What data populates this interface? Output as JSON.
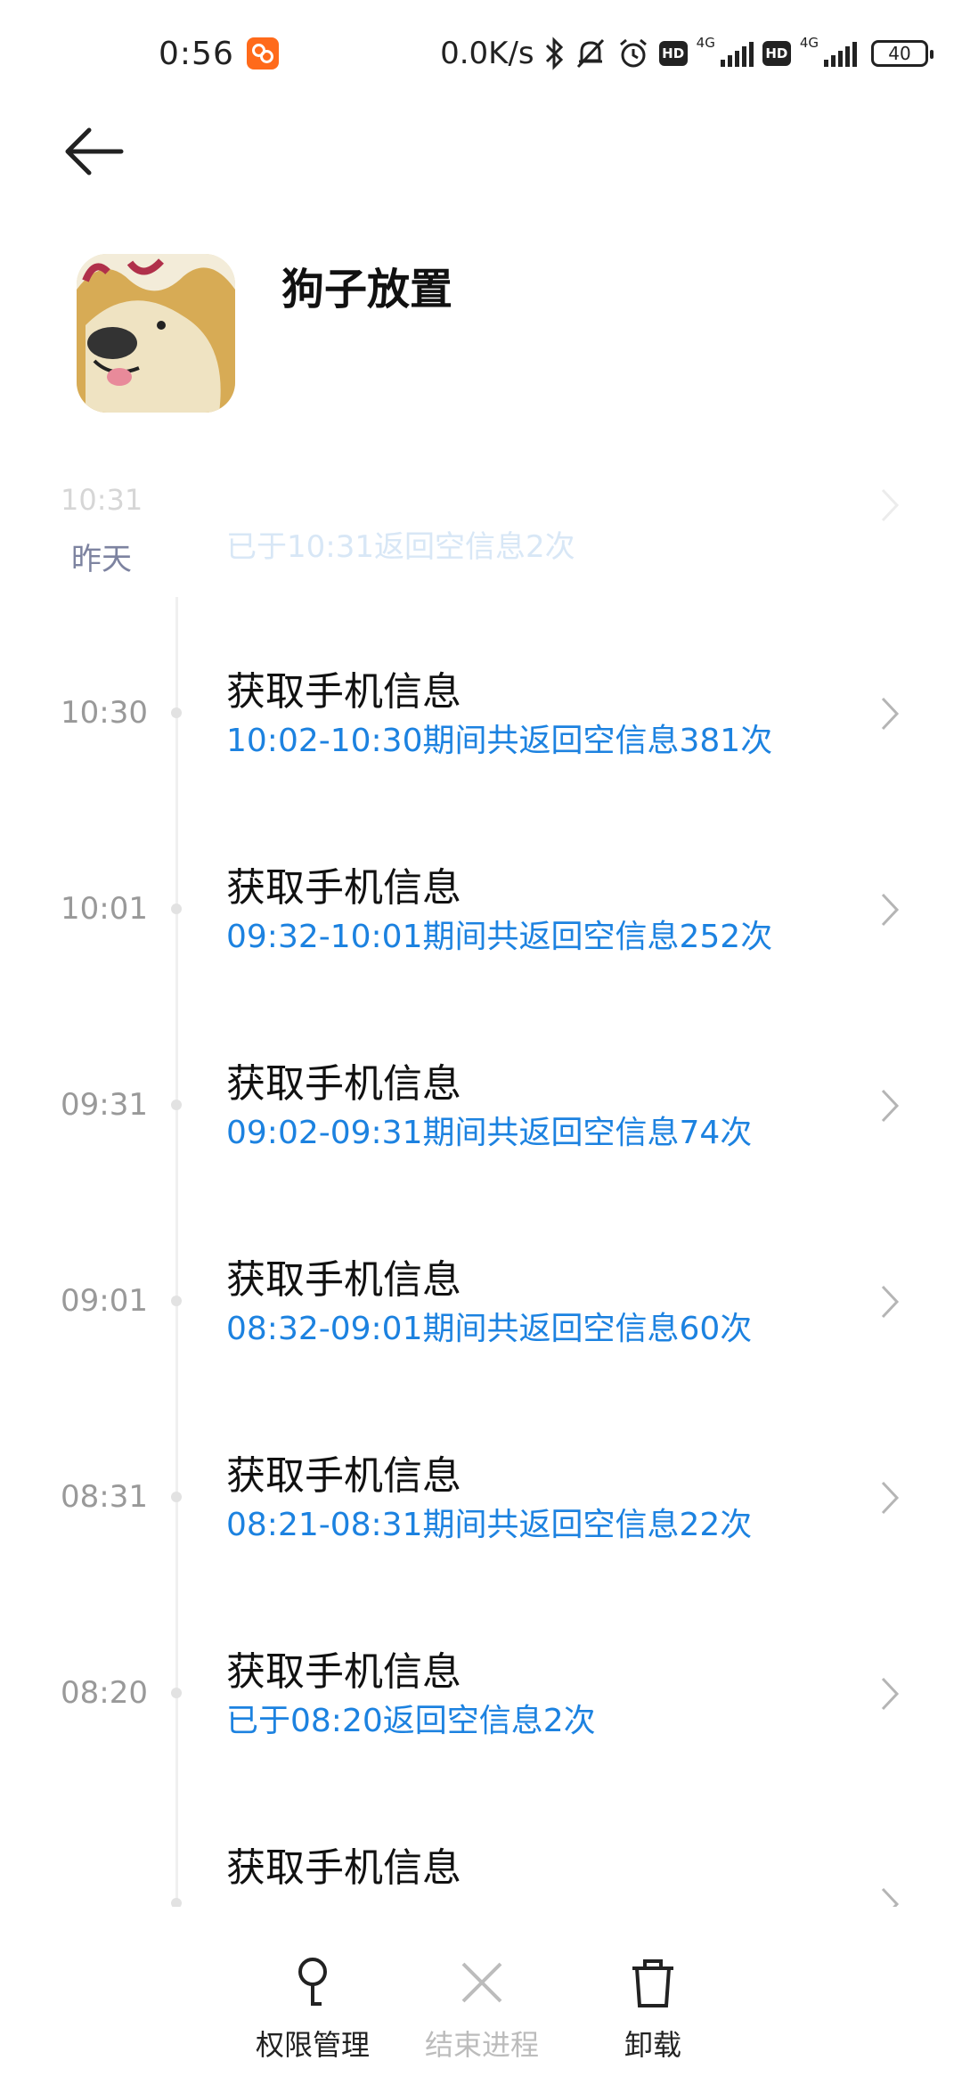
{
  "status_bar": {
    "time": "0:56",
    "speed": "0.0K/s",
    "network_label": "4G",
    "battery_level": "40",
    "icons": [
      "video-app-icon",
      "bluetooth-icon",
      "bell-muted-icon",
      "alarm-icon",
      "hd-icon",
      "signal-icon",
      "battery-icon"
    ]
  },
  "header": {
    "app_name": "狗子放置"
  },
  "timeline": {
    "faded_row": {
      "time": "10:31",
      "desc": "已于10:31返回空信息2次"
    },
    "day_label": "昨天",
    "entries": [
      {
        "time": "10:30",
        "title": "获取手机信息",
        "desc": "10:02-10:30期间共返回空信息381次"
      },
      {
        "time": "10:01",
        "title": "获取手机信息",
        "desc": "09:32-10:01期间共返回空信息252次"
      },
      {
        "time": "09:31",
        "title": "获取手机信息",
        "desc": "09:02-09:31期间共返回空信息74次"
      },
      {
        "time": "09:01",
        "title": "获取手机信息",
        "desc": "08:32-09:01期间共返回空信息60次"
      },
      {
        "time": "08:31",
        "title": "获取手机信息",
        "desc": "08:21-08:31期间共返回空信息22次"
      },
      {
        "time": "08:20",
        "title": "获取手机信息",
        "desc": "已于08:20返回空信息2次"
      },
      {
        "time": "",
        "title": "获取手机信息",
        "desc": ""
      }
    ]
  },
  "bottom_bar": {
    "permissions_label": "权限管理",
    "end_process_label": "结束进程",
    "uninstall_label": "卸载"
  },
  "colors": {
    "accent": "#1c82e0",
    "time_text": "#999999",
    "disabled": "#bcbcbc",
    "day_label": "#7d83a0"
  }
}
